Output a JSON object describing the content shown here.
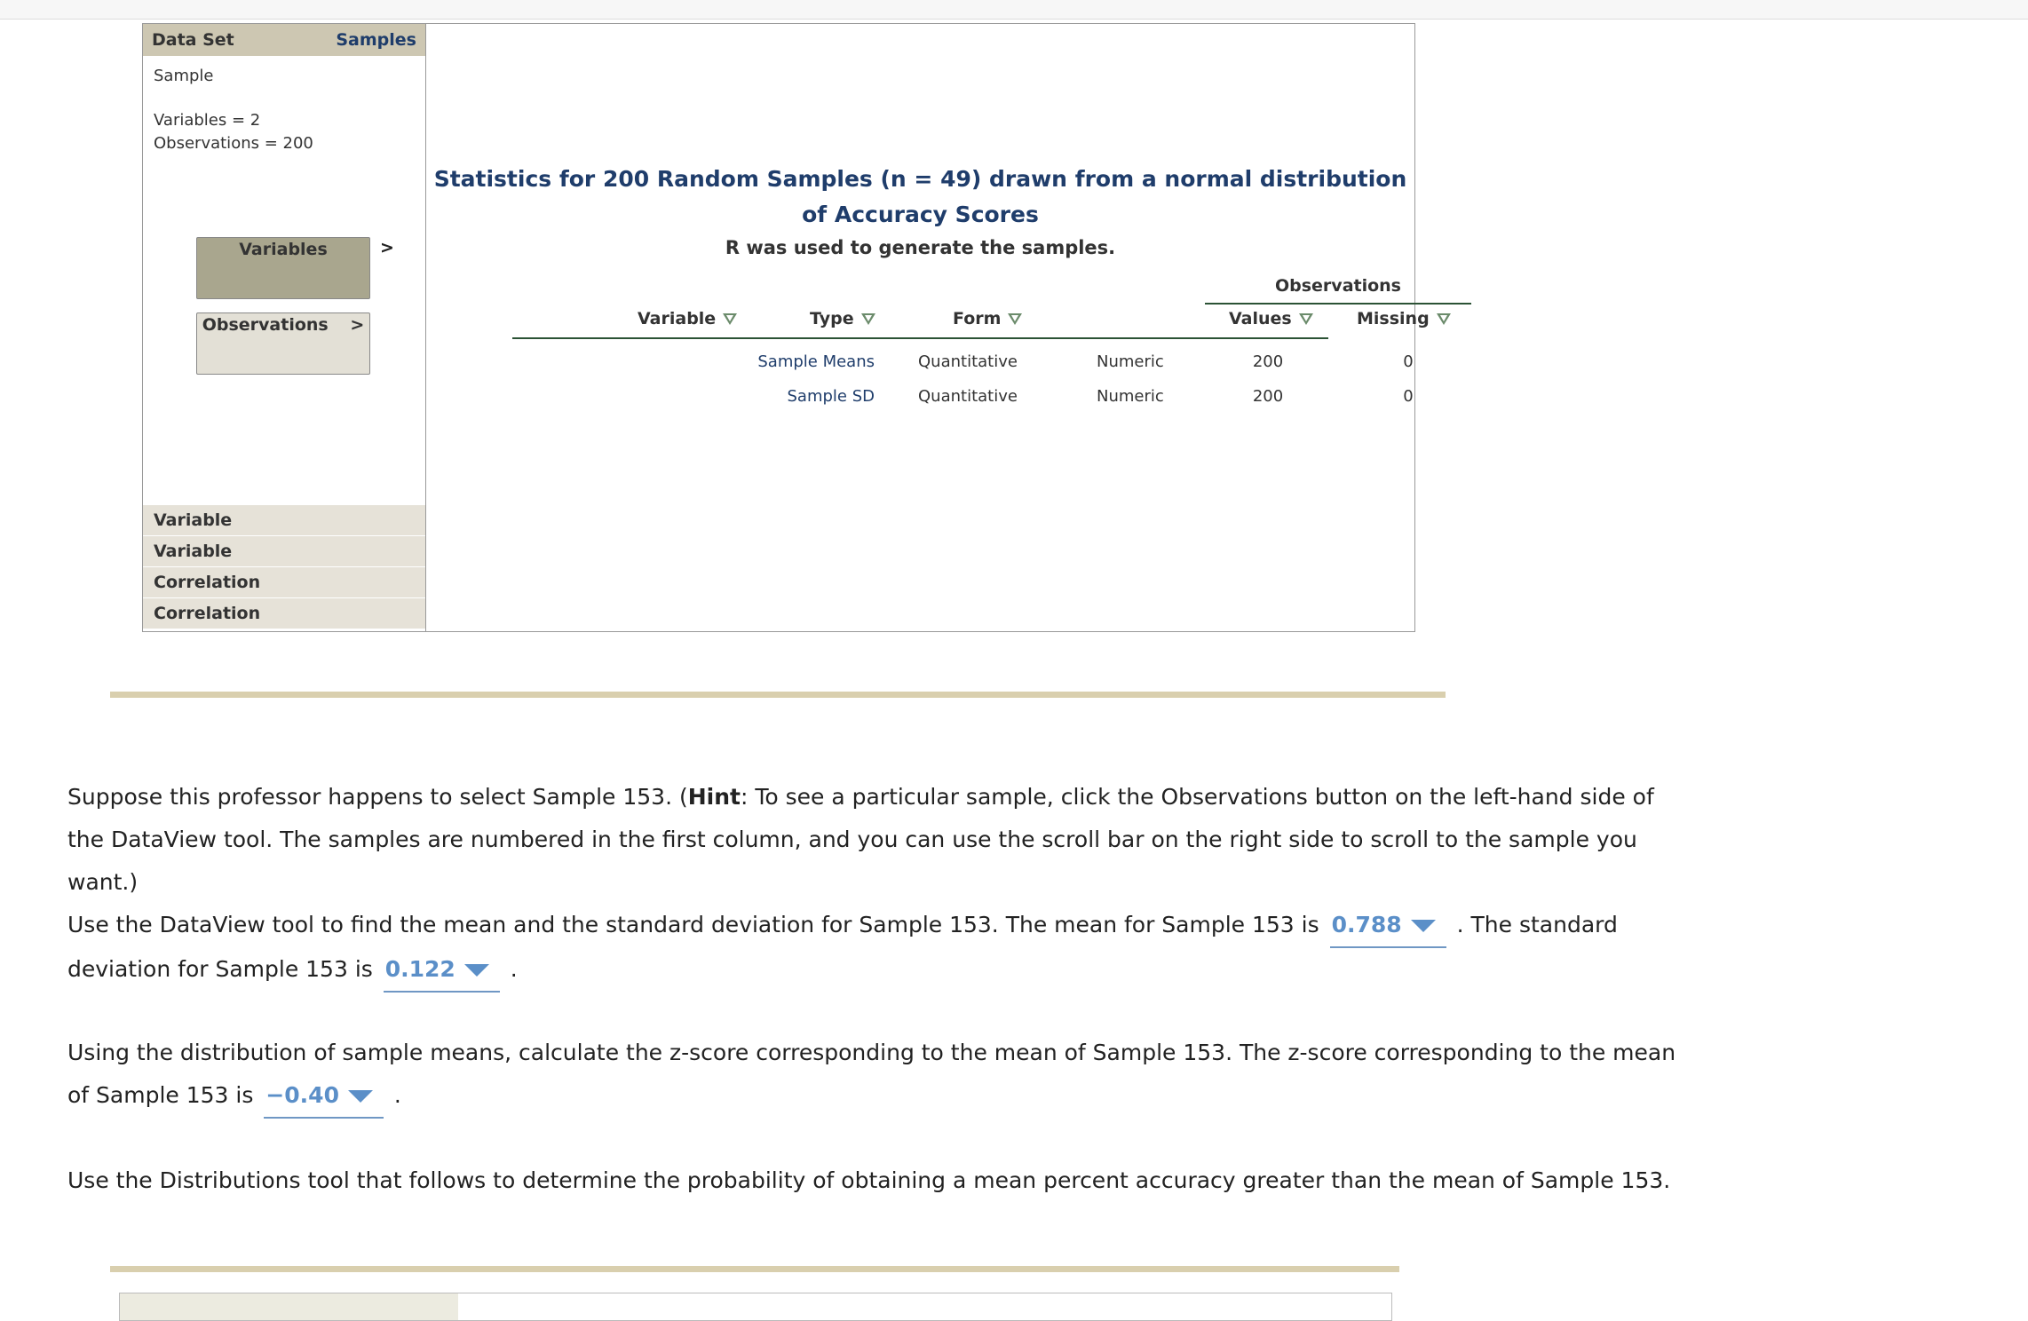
{
  "dataview": {
    "header_left": "Data Set",
    "header_right": "Samples",
    "dataset_name": "Sample",
    "variables_count": "Variables = 2",
    "observations_count": "Observations = 200",
    "variables_button": "Variables",
    "variables_chevron": ">",
    "observations_button": "Observations",
    "observations_chevron": ">",
    "side_list": [
      "Variable",
      "Variable",
      "Correlation",
      "Correlation"
    ],
    "title": "Statistics for 200 Random Samples (n = 49) drawn from a normal distribution of Accuracy Scores",
    "subtitle": "R was used to generate the samples.",
    "observations_group": "Observations",
    "columns": [
      "Variable",
      "Type",
      "Form",
      "Values",
      "Missing"
    ],
    "rows": [
      {
        "variable": "Sample Means",
        "type": "Quantitative",
        "form": "Numeric",
        "values": "200",
        "missing": "0"
      },
      {
        "variable": "Sample SD",
        "type": "Quantitative",
        "form": "Numeric",
        "values": "200",
        "missing": "0"
      }
    ]
  },
  "content": {
    "p1_a": "Suppose this professor happens to select Sample 153. (",
    "p1_hint": "Hint",
    "p1_b": ": To see a particular sample, click the Observations button on the left-hand side of the DataView tool. The samples are numbered in the first column, and you can use the scroll bar on the right side to scroll to the sample you want.)",
    "p2_a": "Use the DataView tool to find the mean and the standard deviation for Sample 153. The mean for Sample 153 is",
    "p2_mean": "0.788",
    "p2_b": ". The standard deviation for Sample 153 is",
    "p2_sd": "0.122",
    "p2_c": ".",
    "p3_a": "Using the distribution of sample means, calculate the z-score corresponding to the mean of Sample 153. The z-score corresponding to the mean of Sample 153 is",
    "p3_z": "−0.40",
    "p3_b": ".",
    "p4": "Use the Distributions tool that follows to determine the probability of obtaining a mean percent accuracy greater than the mean of Sample 153."
  },
  "colors": {
    "accent_blue": "#1f3d6b",
    "answer_blue": "#5b8fc8",
    "rule_tan": "#d9cfae",
    "header_tan": "#cdc7b2"
  }
}
